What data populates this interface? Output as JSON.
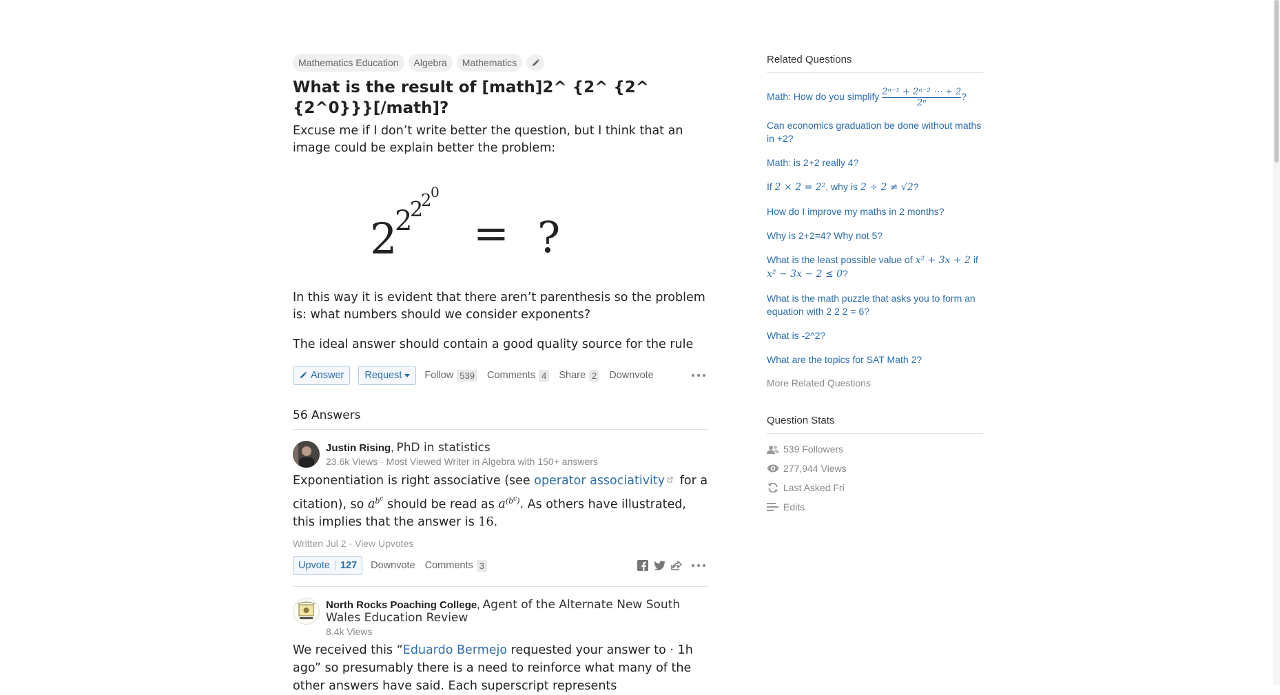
{
  "question": {
    "topics": [
      "Mathematics Education",
      "Algebra",
      "Mathematics"
    ],
    "title": "What is the result of [math]2^ {2^ {2^ {2^0}}}[/math]?",
    "body_p1": "Excuse me if I don’t write better the question, but I think that an image could be explain better the problem:",
    "math_image": {
      "base": "2",
      "e1": "2",
      "e2": "2",
      "e3": "2",
      "e4": "0",
      "equals": "=",
      "rhs": "?"
    },
    "body_p2": "In this way it is evident that there aren’t parenthesis so the problem is: what numbers should we consider exponents?",
    "body_p3": "The ideal answer should contain a good quality source for the rule",
    "actions": {
      "answer": "Answer",
      "request": "Request",
      "follow": "Follow",
      "follow_count": "539",
      "comments": "Comments",
      "comments_count": "4",
      "share": "Share",
      "share_count": "2",
      "downvote": "Downvote"
    }
  },
  "answers_count_label": "56 Answers",
  "answers": [
    {
      "author": "Justin Rising",
      "credential": "PhD in statistics",
      "meta": "23.6k Views · Most Viewed Writer in Algebra with 150+ answers",
      "text_a": "Exponentiation is right associative (see ",
      "link": "operator associativity",
      "text_b": " for a citation), so ",
      "text_c": " should be read as ",
      "text_d": ". As others have illustrated, this implies that the answer is ",
      "answer_value": "16",
      "text_e": ".",
      "written": "Written Jul 2 · View Upvotes",
      "upvote": "Upvote",
      "upvote_count": "127",
      "downvote": "Downvote",
      "comments": "Comments",
      "comments_count": "3"
    },
    {
      "author": "North Rocks Poaching College",
      "credential": "Agent of the Alternate New South Wales Education Review",
      "meta": "8.4k Views",
      "text_a": "We received this “",
      "link": "Eduardo Bermejo",
      "text_b": " requested your answer to · 1h ago” so presumably there is a need to reinforce what many of the other answers have said. Each superscript represents"
    }
  ],
  "sidebar": {
    "related_title": "Related Questions",
    "related": [
      "How do you simplify",
      "Can economics graduation be done without maths in +2?",
      "Math: is 2+2 really 4?",
      "If",
      "How do I improve my maths in 2 months?",
      "Why is 2+2=4? Why not 5?",
      "What is the least possible value of",
      "What is the math puzzle that asks you to form an equation with 2 2 2 = 6?",
      "What is -2^2?",
      "What are the topics for SAT Math 2?"
    ],
    "related_parts": {
      "q1_prefix": "Math: How do you simplify",
      "q1_math": "2ⁿ⁻¹ + 2ⁿ⁻² ⋯ + 2",
      "q1_den": "2ⁿ",
      "q1_end": "?",
      "q4_a": "If",
      "q4_m1": "2 × 2 = 2²",
      "q4_b": ", why is",
      "q4_m2": "2 ÷ 2 ≠ √2",
      "q4_end": "?",
      "q7_a": "What is the least possible value of",
      "q7_m1": "x² + 3x + 2",
      "q7_b": "if",
      "q7_m2": "x² − 3x − 2 ≤ 0",
      "q7_end": "?"
    },
    "more": "More Related Questions",
    "stats_title": "Question Stats",
    "stats": {
      "followers": "539 Followers",
      "views": "277,944 Views",
      "last_asked": "Last Asked Fri",
      "edits": "Edits"
    }
  },
  "colors": {
    "link": "#2b6dad",
    "muted": "#888888",
    "topic_bg": "#eff0f2"
  }
}
